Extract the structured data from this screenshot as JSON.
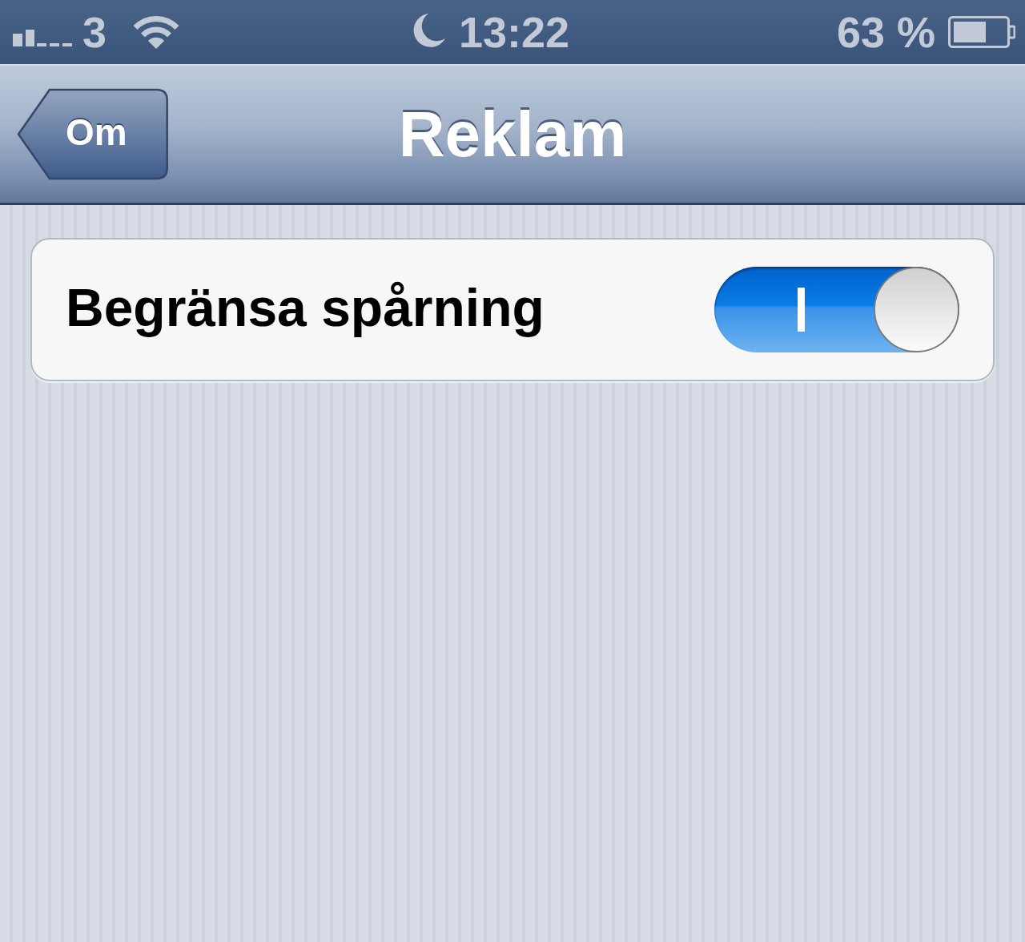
{
  "status_bar": {
    "carrier": "3",
    "time": "13:22",
    "battery": "63 %"
  },
  "nav_bar": {
    "back_button": "Om",
    "title": "Reklam"
  },
  "settings": [
    {
      "label": "Begränsa spårning",
      "on": true
    }
  ]
}
